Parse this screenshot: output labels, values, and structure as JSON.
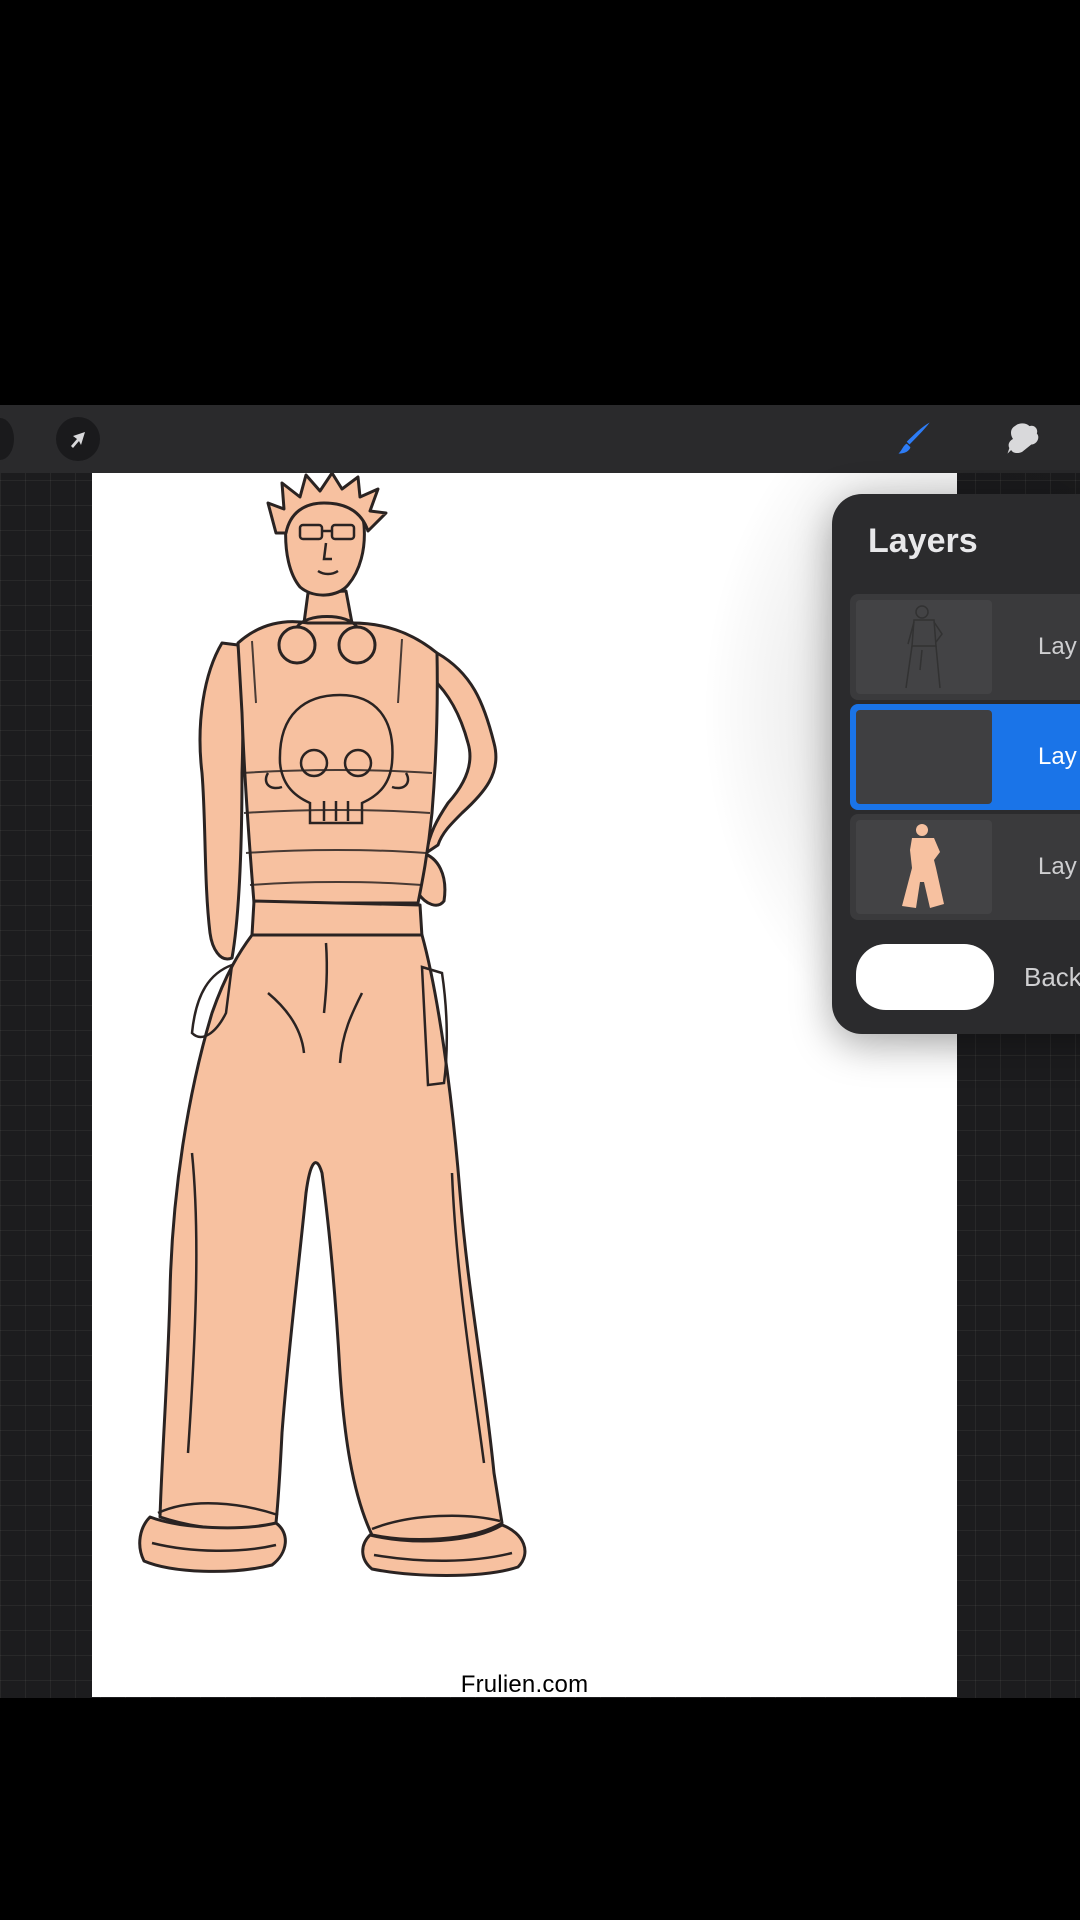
{
  "toolbar": {
    "left_tool_icon": "partial-tool-icon",
    "selection_icon": "selection-arrow-icon",
    "brush_icon": "brush-icon",
    "smudge_icon": "smudge-icon",
    "accent_color": "#2d7cf6"
  },
  "canvas": {
    "watermark": "Frulien.com",
    "skin_color": "#f7c1a0",
    "line_color": "#2a2322"
  },
  "layers_panel": {
    "title": "Layers",
    "layers": [
      {
        "label": "Lay",
        "thumbnail": "sketch-thumbnail",
        "selected": false
      },
      {
        "label": "Lay",
        "thumbnail": "empty-thumbnail",
        "selected": true
      },
      {
        "label": "Lay",
        "thumbnail": "color-fill-thumbnail",
        "selected": false
      }
    ],
    "background": {
      "label": "Back",
      "color": "#ffffff"
    },
    "selected_color": "#1a74e8"
  }
}
